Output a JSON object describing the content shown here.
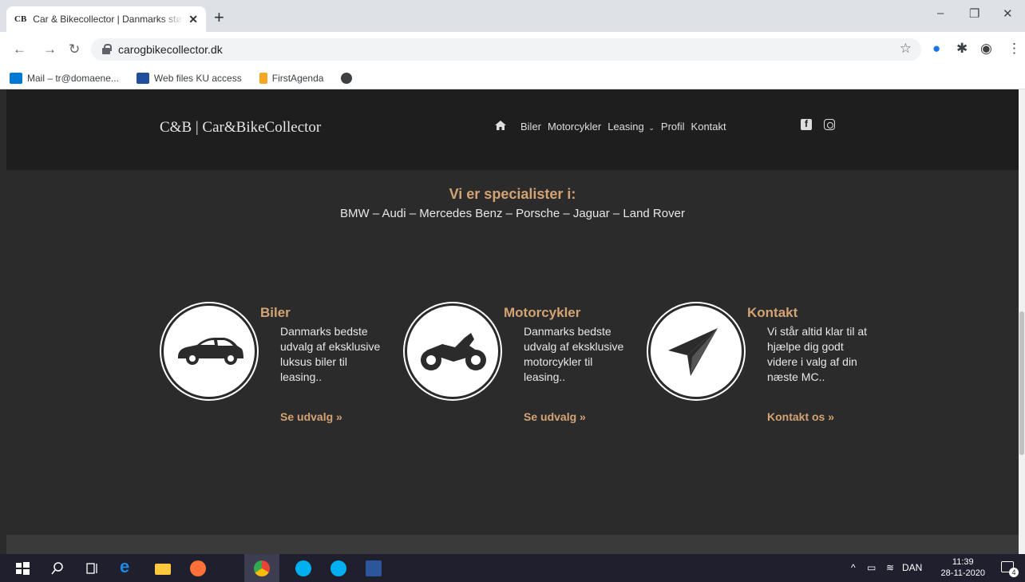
{
  "browser": {
    "tab_icon_text": "CB",
    "tab_title": "Car & Bikecollector | Danmarks største udvalg",
    "tab_close": "✕",
    "new_tab": "+",
    "url": "carogbikecollector.dk",
    "window_controls": [
      "–",
      "❐",
      "✕"
    ]
  },
  "bookmarks": [
    {
      "label": "Mail – tr@domaene...",
      "color": "#0078d4"
    },
    {
      "label": "Web files KU access",
      "color": "#1f4e9c"
    },
    {
      "label": "FirstAgenda",
      "color": "#f5a623"
    },
    {
      "label": "",
      "color": "#3c4043"
    }
  ],
  "site": {
    "logo": "C&B | Car&BikeCollector",
    "nav": {
      "biler": "Biler",
      "motorcykler": "Motorcykler",
      "leasing": "Leasing",
      "leasing_caret": "⌄",
      "profil": "Profil",
      "kontakt": "Kontakt"
    },
    "specialists_title": "Vi er specialister i:",
    "specialists_brands": "BMW – Audi – Mercedes Benz – Porsche – Jaguar – Land Rover",
    "features": [
      {
        "title": "Biler",
        "text": "Danmarks bedste udvalg af eksklusive luksus biler til leasing..",
        "link": "Se udvalg »"
      },
      {
        "title": "Motorcykler",
        "text": "Danmarks bedste udvalg af eksklusive motorcykler til leasing..",
        "link": "Se udvalg »"
      },
      {
        "title": "Kontakt",
        "text": "Vi står altid klar til at hjælpe dig godt videre i valg af din næste MC..",
        "link": "Kontakt os »"
      }
    ]
  },
  "taskbar": {
    "language": "DAN",
    "time": "11:39",
    "date": "28-11-2020",
    "notification_count": "4"
  },
  "colors": {
    "accent": "#d4a373",
    "page_bg": "#2b2b2b",
    "header_bg": "#1e1e1e"
  }
}
